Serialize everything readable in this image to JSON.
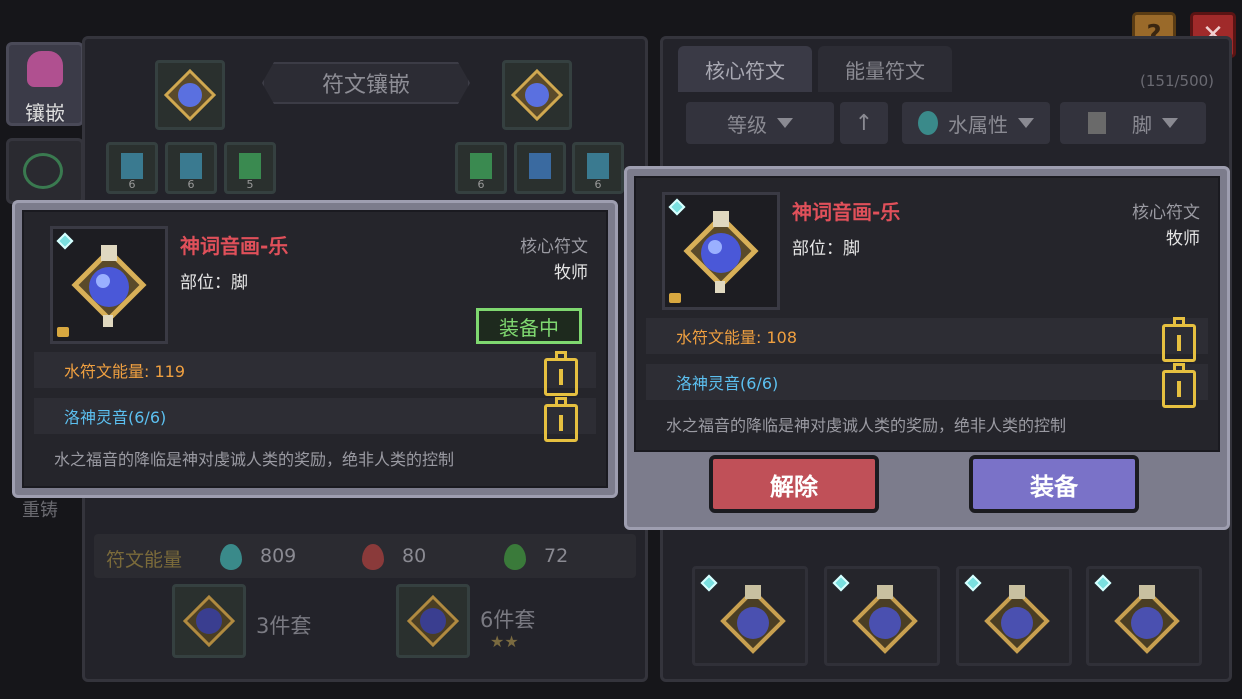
{
  "side": {
    "inlay_label": "镶嵌",
    "recast_label": "重铸"
  },
  "left_panel": {
    "title": "符文镶嵌",
    "slot_counts": [
      "6",
      "6",
      "5",
      "6",
      "",
      "6"
    ],
    "energy_label": "符文能量",
    "energy_values": [
      "809",
      "80",
      "72"
    ],
    "set1_label": "3件套",
    "set2_label": "6件套"
  },
  "right_panel": {
    "tabs": [
      "核心符文",
      "能量符文"
    ],
    "count": "(151/500)",
    "filters": {
      "level": "等级",
      "element": "水属性",
      "part": "脚"
    }
  },
  "popup_left": {
    "name": "神词音画-乐",
    "part": "部位：脚",
    "rune_type": "核心符文",
    "class": "牧师",
    "equipped_badge": "装备中",
    "stat1": "水符文能量: 119",
    "stat2": "洛神灵音(6/6)",
    "description": "水之福音的降临是神对虔诚人类的奖励，绝非人类的控制"
  },
  "popup_right": {
    "name": "神词音画-乐",
    "part": "部位：脚",
    "rune_type": "核心符文",
    "class": "牧师",
    "stat1": "水符文能量: 108",
    "stat2": "洛神灵音(6/6)",
    "description": "水之福音的降临是神对虔诚人类的奖励，绝非人类的控制",
    "remove_label": "解除",
    "equip_label": "装备"
  },
  "top": {
    "help_icon": "?",
    "close_icon": "✕"
  },
  "colors": {
    "name": "#e0505a",
    "energy": "#f0a040",
    "skill": "#5cc0f0",
    "equipped": "#7fd870",
    "lock": "#e6c040",
    "remove_btn": "#c05058",
    "equip_btn": "#7a72c8"
  }
}
